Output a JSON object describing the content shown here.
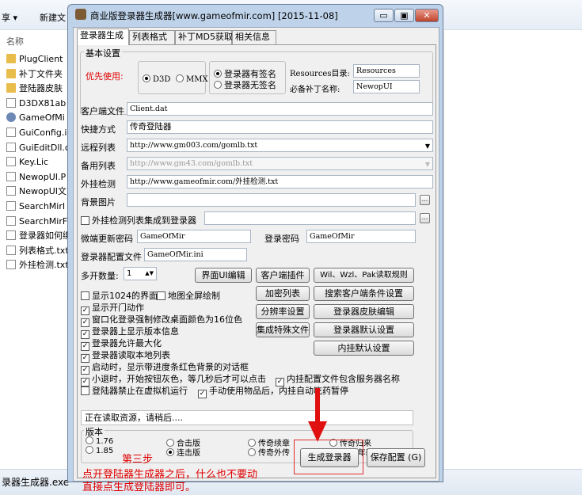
{
  "explorer": {
    "menu": [
      "享 ▾",
      "新建文"
    ],
    "column_header": "名称",
    "files": [
      {
        "name": "PlugClient",
        "icon": "folder-icon"
      },
      {
        "name": "补丁文件夹",
        "icon": "folder-icon"
      },
      {
        "name": "登陆器皮肤",
        "icon": "folder-icon"
      },
      {
        "name": "D3DX81ab",
        "icon": "file-icon"
      },
      {
        "name": "GameOfMi",
        "icon": "gear-icon"
      },
      {
        "name": "GuiConfig.i",
        "icon": "file-icon"
      },
      {
        "name": "GuiEditDll.c",
        "icon": "file-icon"
      },
      {
        "name": "Key.Lic",
        "icon": "file-icon"
      },
      {
        "name": "NewopUI.P",
        "icon": "file-icon"
      },
      {
        "name": "NewopUI文",
        "icon": "file-icon"
      },
      {
        "name": "SearchMirI",
        "icon": "file-icon"
      },
      {
        "name": "SearchMirF",
        "icon": "file-icon"
      },
      {
        "name": "登录器如何绑",
        "icon": "file-icon"
      },
      {
        "name": "列表格式.txt",
        "icon": "file-icon"
      },
      {
        "name": "外挂检测.txt",
        "icon": "file-icon"
      }
    ],
    "selected_file": "录器生成器.exe"
  },
  "window": {
    "title": "商业版登录器生成器[www.gameofmir.com] [2015-11-08]",
    "min_label": "▭",
    "max_label": "▣",
    "close_label": "✕"
  },
  "tabs": [
    "登录器生成",
    "列表格式",
    "补丁MD5获取",
    "相关信息"
  ],
  "basic": {
    "group_label": "基本设置",
    "priority_label": "优先使用:",
    "render_options": [
      {
        "label": "D3D",
        "selected": true
      },
      {
        "label": "MMX",
        "selected": false
      }
    ],
    "sign_options": [
      {
        "label": "登录器有签名",
        "selected": true
      },
      {
        "label": "登录器无签名",
        "selected": false
      }
    ],
    "resources_label": "Resources目录:",
    "resources_value": "Resources",
    "patch_label": "必备补丁名称:",
    "patch_value": "NewopUI"
  },
  "fields": {
    "client_file_label": "客户端文件",
    "client_file_value": "Client.dat",
    "shortcut_label": "快捷方式",
    "shortcut_value": "传奇登陆器",
    "remote_list_label": "远程列表",
    "remote_list_value": "http://www.gm003.com/gomlb.txt",
    "backup_list_label": "备用列表",
    "backup_list_value": "http://www.gm43.com/gomlb.txt",
    "plugin_check_label": "外挂检测",
    "plugin_check_value": "http://www.gameofmir.com/外挂检测.txt",
    "bg_label": "背景图片",
    "bg_value": "",
    "integrate_label": "外挂检测列表集成到登录器",
    "micro_pwd_label": "微端更新密码",
    "micro_pwd_value": "GameOfMir",
    "login_pwd_label": "登录密码",
    "login_pwd_value": "GameOfMir",
    "config_label": "登录器配置文件",
    "config_value": "GameOfMir.ini",
    "multi_label": "多开数量:",
    "multi_value": "1"
  },
  "buttons": {
    "ui_edit": "界面UI编辑",
    "client_plugin": "客户端插件",
    "read_rules": "Wil、Wzl、Pak读取规则",
    "encrypt_list": "加密列表",
    "search_client": "搜索客户端条件设置",
    "resolution": "分辨率设置",
    "skin_edit": "登录器皮肤编辑",
    "integrate_special": "集成特殊文件",
    "login_defaults": "登录器默认设置",
    "plugin_defaults": "内挂默认设置",
    "generate": "生成登录器",
    "save_config": "保存配置 (G)",
    "browse": "..."
  },
  "checks": [
    {
      "label": "显示1024的界面",
      "checked": false
    },
    {
      "label": "地图全屏绘制",
      "checked": false
    },
    {
      "label": "显示开门动作",
      "checked": true
    },
    {
      "label": "窗口化登录强制修改桌面颜色为16位色",
      "checked": true
    },
    {
      "label": "登录器上显示版本信息",
      "checked": true
    },
    {
      "label": "登录器允许最大化",
      "checked": true
    },
    {
      "label": "登录器读取本地列表",
      "checked": true
    },
    {
      "label": "启动时，显示带进度条红色背景的对话框",
      "checked": true
    },
    {
      "label": "小退时，开始按钮灰色，等几秒后才可以点击",
      "checked": true
    },
    {
      "label": "内挂配置文件包含服务器名称",
      "checked": true
    },
    {
      "label": "登陆器禁止在虚拟机运行",
      "checked": false
    },
    {
      "label": "手动使用物品后，内挂自动吃药暂停",
      "checked": true
    }
  ],
  "status_text": "正在读取资源，请稍后....",
  "version": {
    "group_label": "版本",
    "options": [
      {
        "label": "1.76",
        "selected": false
      },
      {
        "label": "1.85",
        "selected": false
      },
      {
        "label": "合击版",
        "selected": false
      },
      {
        "label": "连击版",
        "selected": true
      },
      {
        "label": "传奇续章",
        "selected": false
      },
      {
        "label": "传奇外传",
        "selected": false
      },
      {
        "label": "传奇归来",
        "selected": false
      },
      {
        "label": "13周年新界面",
        "selected": false
      }
    ]
  },
  "annotation": {
    "step": "第三步",
    "line1": "点开登陆器生成器之后，什么也不要动",
    "line2": "直接点生成登陆器即可。"
  },
  "colors": {
    "annotation_red": "#e00000"
  }
}
